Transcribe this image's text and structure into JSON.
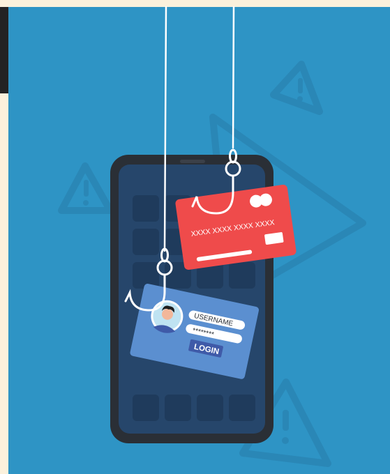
{
  "colors": {
    "background": "#2e94c5",
    "top_band": "#fbf1dc",
    "phone_body": "#2a2f36",
    "phone_screen": "#26466b",
    "app_tile": "#1f3b5c",
    "warning_shape": "#2a87b6",
    "credit_card": "#ef4b4b",
    "login_card": "#5b8fd0",
    "login_button": "#3f5aa8",
    "fishing_line": "#ffffff"
  },
  "icons": {
    "warning": "warning-triangle-icon",
    "play": "play-triangle-icon",
    "hook": "fishing-hook-icon",
    "avatar": "user-avatar-icon"
  },
  "credit_card": {
    "number": "XXXX XXXX XXXX XXXX"
  },
  "login_card": {
    "username_label": "USERNAME",
    "password_mask": "********",
    "login_label": "LOGIN"
  }
}
